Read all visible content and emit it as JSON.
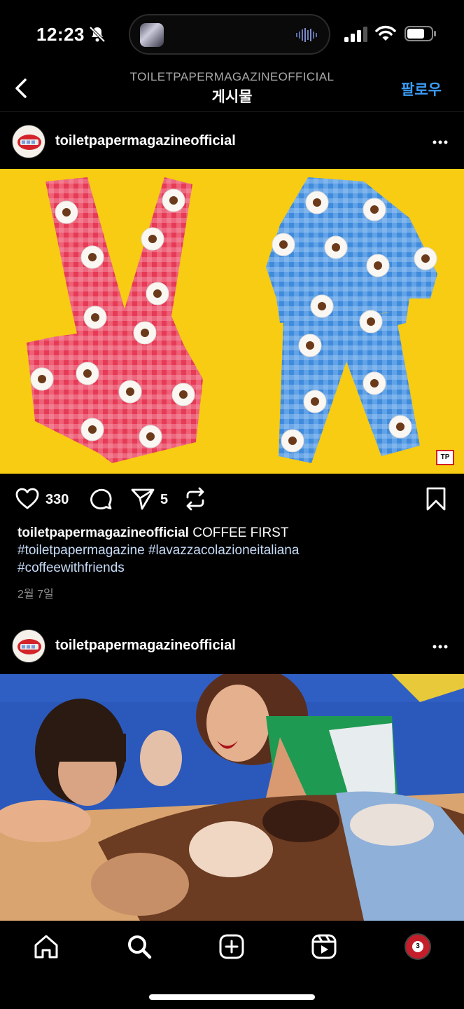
{
  "status_bar": {
    "time": "12:23",
    "icons": [
      "bell-muted-icon",
      "cellular-signal-icon",
      "wifi-icon",
      "battery-icon"
    ]
  },
  "header": {
    "subtitle": "TOILETPAPERMAGAZINEOFFICIAL",
    "title": "게시물",
    "follow_label": "팔로우",
    "accent_color": "#3b9cf6"
  },
  "posts": [
    {
      "username": "toiletpapermagazineofficial",
      "image_logo": "TP",
      "likes": "330",
      "shares": "5",
      "caption_text": "COFFEE FIRST",
      "hashtags_line1": "#toiletpapermagazine #lavazzacolazioneitaliana",
      "hashtags_line2": "#coffeewithfriends",
      "date": "2월 7일"
    },
    {
      "username": "toiletpapermagazineofficial"
    }
  ],
  "bottom_nav": {
    "items": [
      "home-icon",
      "search-icon",
      "create-icon",
      "reels-icon",
      "profile-icon"
    ],
    "profile_badge": "3"
  }
}
